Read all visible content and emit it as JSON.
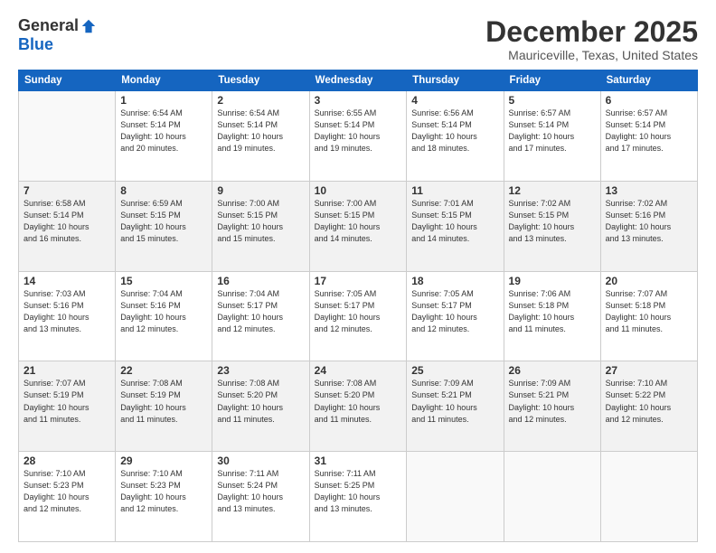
{
  "logo": {
    "general": "General",
    "blue": "Blue"
  },
  "header": {
    "month": "December 2025",
    "location": "Mauriceville, Texas, United States"
  },
  "weekdays": [
    "Sunday",
    "Monday",
    "Tuesday",
    "Wednesday",
    "Thursday",
    "Friday",
    "Saturday"
  ],
  "weeks": [
    [
      {
        "day": "",
        "sunrise": "",
        "sunset": "",
        "daylight": ""
      },
      {
        "day": "1",
        "sunrise": "Sunrise: 6:54 AM",
        "sunset": "Sunset: 5:14 PM",
        "daylight": "Daylight: 10 hours and 20 minutes."
      },
      {
        "day": "2",
        "sunrise": "Sunrise: 6:54 AM",
        "sunset": "Sunset: 5:14 PM",
        "daylight": "Daylight: 10 hours and 19 minutes."
      },
      {
        "day": "3",
        "sunrise": "Sunrise: 6:55 AM",
        "sunset": "Sunset: 5:14 PM",
        "daylight": "Daylight: 10 hours and 19 minutes."
      },
      {
        "day": "4",
        "sunrise": "Sunrise: 6:56 AM",
        "sunset": "Sunset: 5:14 PM",
        "daylight": "Daylight: 10 hours and 18 minutes."
      },
      {
        "day": "5",
        "sunrise": "Sunrise: 6:57 AM",
        "sunset": "Sunset: 5:14 PM",
        "daylight": "Daylight: 10 hours and 17 minutes."
      },
      {
        "day": "6",
        "sunrise": "Sunrise: 6:57 AM",
        "sunset": "Sunset: 5:14 PM",
        "daylight": "Daylight: 10 hours and 17 minutes."
      }
    ],
    [
      {
        "day": "7",
        "sunrise": "Sunrise: 6:58 AM",
        "sunset": "Sunset: 5:14 PM",
        "daylight": "Daylight: 10 hours and 16 minutes."
      },
      {
        "day": "8",
        "sunrise": "Sunrise: 6:59 AM",
        "sunset": "Sunset: 5:15 PM",
        "daylight": "Daylight: 10 hours and 15 minutes."
      },
      {
        "day": "9",
        "sunrise": "Sunrise: 7:00 AM",
        "sunset": "Sunset: 5:15 PM",
        "daylight": "Daylight: 10 hours and 15 minutes."
      },
      {
        "day": "10",
        "sunrise": "Sunrise: 7:00 AM",
        "sunset": "Sunset: 5:15 PM",
        "daylight": "Daylight: 10 hours and 14 minutes."
      },
      {
        "day": "11",
        "sunrise": "Sunrise: 7:01 AM",
        "sunset": "Sunset: 5:15 PM",
        "daylight": "Daylight: 10 hours and 14 minutes."
      },
      {
        "day": "12",
        "sunrise": "Sunrise: 7:02 AM",
        "sunset": "Sunset: 5:15 PM",
        "daylight": "Daylight: 10 hours and 13 minutes."
      },
      {
        "day": "13",
        "sunrise": "Sunrise: 7:02 AM",
        "sunset": "Sunset: 5:16 PM",
        "daylight": "Daylight: 10 hours and 13 minutes."
      }
    ],
    [
      {
        "day": "14",
        "sunrise": "Sunrise: 7:03 AM",
        "sunset": "Sunset: 5:16 PM",
        "daylight": "Daylight: 10 hours and 13 minutes."
      },
      {
        "day": "15",
        "sunrise": "Sunrise: 7:04 AM",
        "sunset": "Sunset: 5:16 PM",
        "daylight": "Daylight: 10 hours and 12 minutes."
      },
      {
        "day": "16",
        "sunrise": "Sunrise: 7:04 AM",
        "sunset": "Sunset: 5:17 PM",
        "daylight": "Daylight: 10 hours and 12 minutes."
      },
      {
        "day": "17",
        "sunrise": "Sunrise: 7:05 AM",
        "sunset": "Sunset: 5:17 PM",
        "daylight": "Daylight: 10 hours and 12 minutes."
      },
      {
        "day": "18",
        "sunrise": "Sunrise: 7:05 AM",
        "sunset": "Sunset: 5:17 PM",
        "daylight": "Daylight: 10 hours and 12 minutes."
      },
      {
        "day": "19",
        "sunrise": "Sunrise: 7:06 AM",
        "sunset": "Sunset: 5:18 PM",
        "daylight": "Daylight: 10 hours and 11 minutes."
      },
      {
        "day": "20",
        "sunrise": "Sunrise: 7:07 AM",
        "sunset": "Sunset: 5:18 PM",
        "daylight": "Daylight: 10 hours and 11 minutes."
      }
    ],
    [
      {
        "day": "21",
        "sunrise": "Sunrise: 7:07 AM",
        "sunset": "Sunset: 5:19 PM",
        "daylight": "Daylight: 10 hours and 11 minutes."
      },
      {
        "day": "22",
        "sunrise": "Sunrise: 7:08 AM",
        "sunset": "Sunset: 5:19 PM",
        "daylight": "Daylight: 10 hours and 11 minutes."
      },
      {
        "day": "23",
        "sunrise": "Sunrise: 7:08 AM",
        "sunset": "Sunset: 5:20 PM",
        "daylight": "Daylight: 10 hours and 11 minutes."
      },
      {
        "day": "24",
        "sunrise": "Sunrise: 7:08 AM",
        "sunset": "Sunset: 5:20 PM",
        "daylight": "Daylight: 10 hours and 11 minutes."
      },
      {
        "day": "25",
        "sunrise": "Sunrise: 7:09 AM",
        "sunset": "Sunset: 5:21 PM",
        "daylight": "Daylight: 10 hours and 11 minutes."
      },
      {
        "day": "26",
        "sunrise": "Sunrise: 7:09 AM",
        "sunset": "Sunset: 5:21 PM",
        "daylight": "Daylight: 10 hours and 12 minutes."
      },
      {
        "day": "27",
        "sunrise": "Sunrise: 7:10 AM",
        "sunset": "Sunset: 5:22 PM",
        "daylight": "Daylight: 10 hours and 12 minutes."
      }
    ],
    [
      {
        "day": "28",
        "sunrise": "Sunrise: 7:10 AM",
        "sunset": "Sunset: 5:23 PM",
        "daylight": "Daylight: 10 hours and 12 minutes."
      },
      {
        "day": "29",
        "sunrise": "Sunrise: 7:10 AM",
        "sunset": "Sunset: 5:23 PM",
        "daylight": "Daylight: 10 hours and 12 minutes."
      },
      {
        "day": "30",
        "sunrise": "Sunrise: 7:11 AM",
        "sunset": "Sunset: 5:24 PM",
        "daylight": "Daylight: 10 hours and 13 minutes."
      },
      {
        "day": "31",
        "sunrise": "Sunrise: 7:11 AM",
        "sunset": "Sunset: 5:25 PM",
        "daylight": "Daylight: 10 hours and 13 minutes."
      },
      {
        "day": "",
        "sunrise": "",
        "sunset": "",
        "daylight": ""
      },
      {
        "day": "",
        "sunrise": "",
        "sunset": "",
        "daylight": ""
      },
      {
        "day": "",
        "sunrise": "",
        "sunset": "",
        "daylight": ""
      }
    ]
  ]
}
